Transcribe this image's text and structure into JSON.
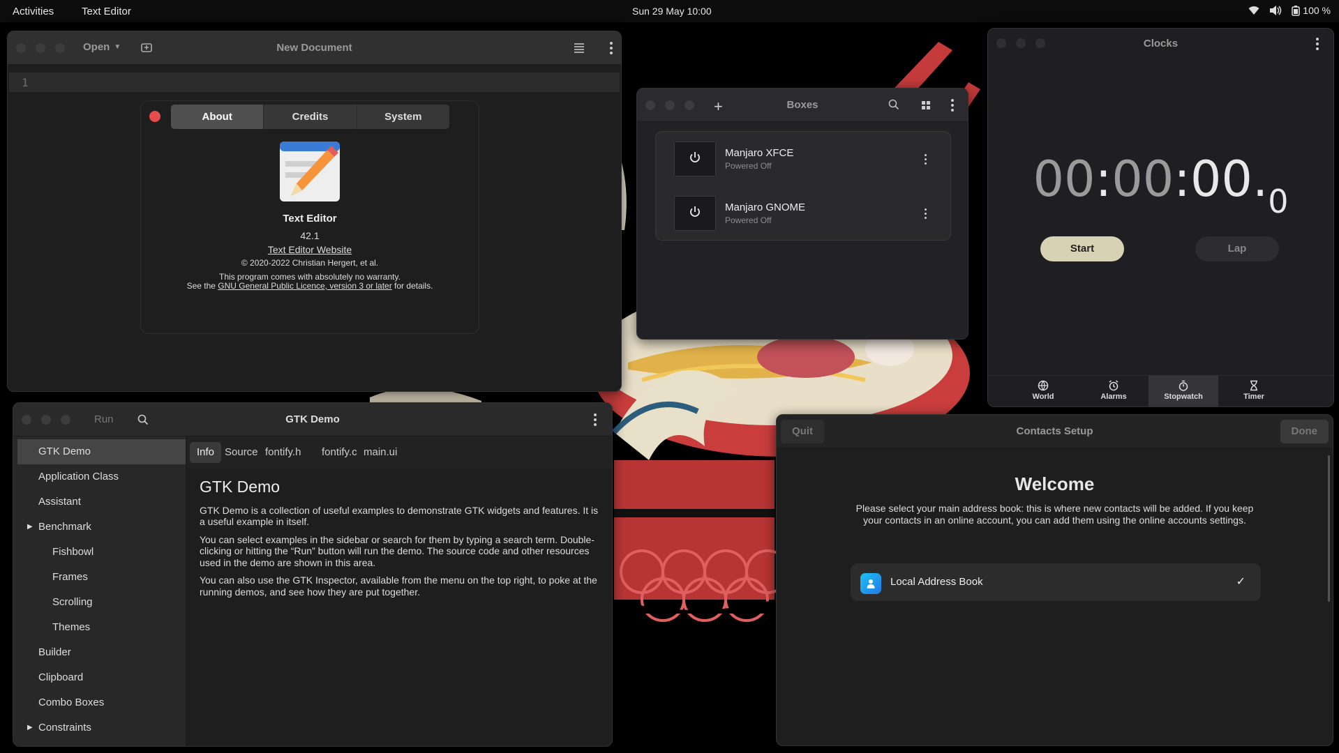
{
  "topbar": {
    "activities": "Activities",
    "app_name": "Text Editor",
    "datetime": "Sun 29 May  10:00",
    "battery": "100 %"
  },
  "text_editor": {
    "open_label": "Open",
    "title": "New Document",
    "line_number": "1"
  },
  "about": {
    "tabs": [
      "About",
      "Credits",
      "System"
    ],
    "app_name": "Text Editor",
    "version": "42.1",
    "website": "Text Editor Website",
    "copyright": "© 2020-2022 Christian Hergert, et al.",
    "warranty": "This program comes with absolutely no warranty.",
    "license_prefix": "See the ",
    "license_link": "GNU General Public Licence, version 3 or later",
    "license_suffix": " for details."
  },
  "boxes": {
    "title": "Boxes",
    "machines": [
      {
        "name": "Manjaro XFCE",
        "status": "Powered Off"
      },
      {
        "name": "Manjaro GNOME",
        "status": "Powered Off"
      }
    ]
  },
  "clocks": {
    "title": "Clocks",
    "stopwatch": {
      "h": "00",
      "sep1": ":",
      "m": "00",
      "sep2": ":",
      "s": "00",
      "dot": ".",
      "frac": "0"
    },
    "start_label": "Start",
    "lap_label": "Lap",
    "tabs": [
      "World",
      "Alarms",
      "Stopwatch",
      "Timer"
    ],
    "active_tab": "Stopwatch"
  },
  "gtk_demo": {
    "title": "GTK Demo",
    "run_label": "Run",
    "sidebar": [
      {
        "label": "GTK Demo",
        "selected": true
      },
      {
        "label": "Application Class"
      },
      {
        "label": "Assistant"
      },
      {
        "label": "Benchmark",
        "expander": true
      },
      {
        "label": "Fishbowl",
        "child": true
      },
      {
        "label": "Frames",
        "child": true
      },
      {
        "label": "Scrolling",
        "child": true
      },
      {
        "label": "Themes",
        "child": true
      },
      {
        "label": "Builder"
      },
      {
        "label": "Clipboard"
      },
      {
        "label": "Combo Boxes"
      },
      {
        "label": "Constraints",
        "expander": true
      }
    ],
    "tabs": [
      "Info",
      "Source",
      "fontify.h",
      "fontify.c",
      "main.ui"
    ],
    "heading": "GTK Demo",
    "paragraphs": [
      "GTK Demo is a collection of useful examples to demonstrate GTK widgets and features. It is a useful example in itself.",
      "You can select examples in the sidebar or search for them by typing a search term. Double-clicking or hitting the “Run” button will run the demo. The source code and other resources used in the demo are shown in this area.",
      "You can also use the GTK Inspector, available from the menu on the top right, to poke at the running demos, and see how they are put together."
    ]
  },
  "contacts": {
    "title": "Contacts Setup",
    "quit_label": "Quit",
    "done_label": "Done",
    "welcome": "Welcome",
    "description": "Please select your main address book: this is where new contacts will be added. If you keep your contacts in an online account, you can add them using the online accounts settings.",
    "address_book": "Local Address Book"
  },
  "colors": {
    "accent_start": "#d7d2b4",
    "close_red": "#e74c4c",
    "address_book_icon": "#1cc1f2"
  }
}
